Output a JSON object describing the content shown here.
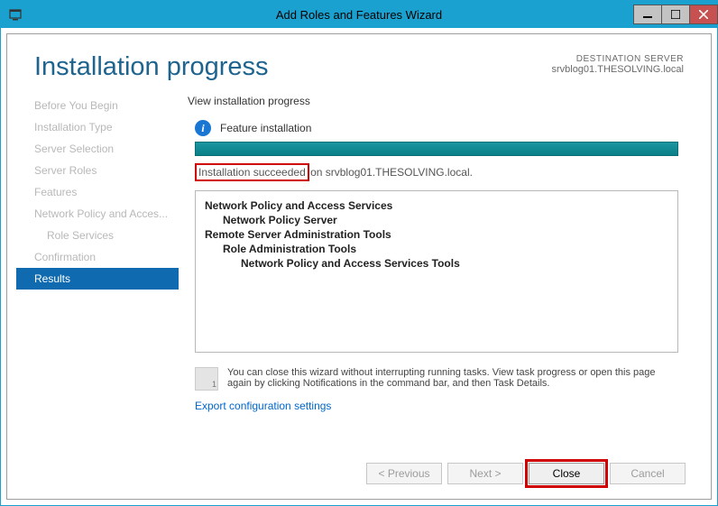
{
  "window": {
    "title": "Add Roles and Features Wizard"
  },
  "header": {
    "title": "Installation progress",
    "dest_label": "DESTINATION SERVER",
    "dest_value": "srvblog01.THESOLVING.local"
  },
  "sidebar": {
    "items": [
      {
        "label": "Before You Begin",
        "active": false
      },
      {
        "label": "Installation Type",
        "active": false
      },
      {
        "label": "Server Selection",
        "active": false
      },
      {
        "label": "Server Roles",
        "active": false
      },
      {
        "label": "Features",
        "active": false
      },
      {
        "label": "Network Policy and Acces...",
        "active": false
      },
      {
        "label": "Role Services",
        "active": false,
        "sub": true
      },
      {
        "label": "Confirmation",
        "active": false
      },
      {
        "label": "Results",
        "active": true
      }
    ]
  },
  "main": {
    "subheading": "View installation progress",
    "status_text": "Feature installation",
    "success_text": "Installation succeeded",
    "success_suffix": " on srvblog01.THESOLVING.local.",
    "features": {
      "group1": "Network Policy and Access Services",
      "group1_item1": "Network Policy Server",
      "group2": "Remote Server Administration Tools",
      "group2_item1": "Role Administration Tools",
      "group2_item1_sub1": "Network Policy and Access Services Tools"
    },
    "notice_text": "You can close this wizard without interrupting running tasks. View task progress or open this page again by clicking Notifications in the command bar, and then Task Details.",
    "notice_badge": "1",
    "export_link": "Export configuration settings"
  },
  "footer": {
    "previous": "< Previous",
    "next": "Next >",
    "close": "Close",
    "cancel": "Cancel"
  }
}
